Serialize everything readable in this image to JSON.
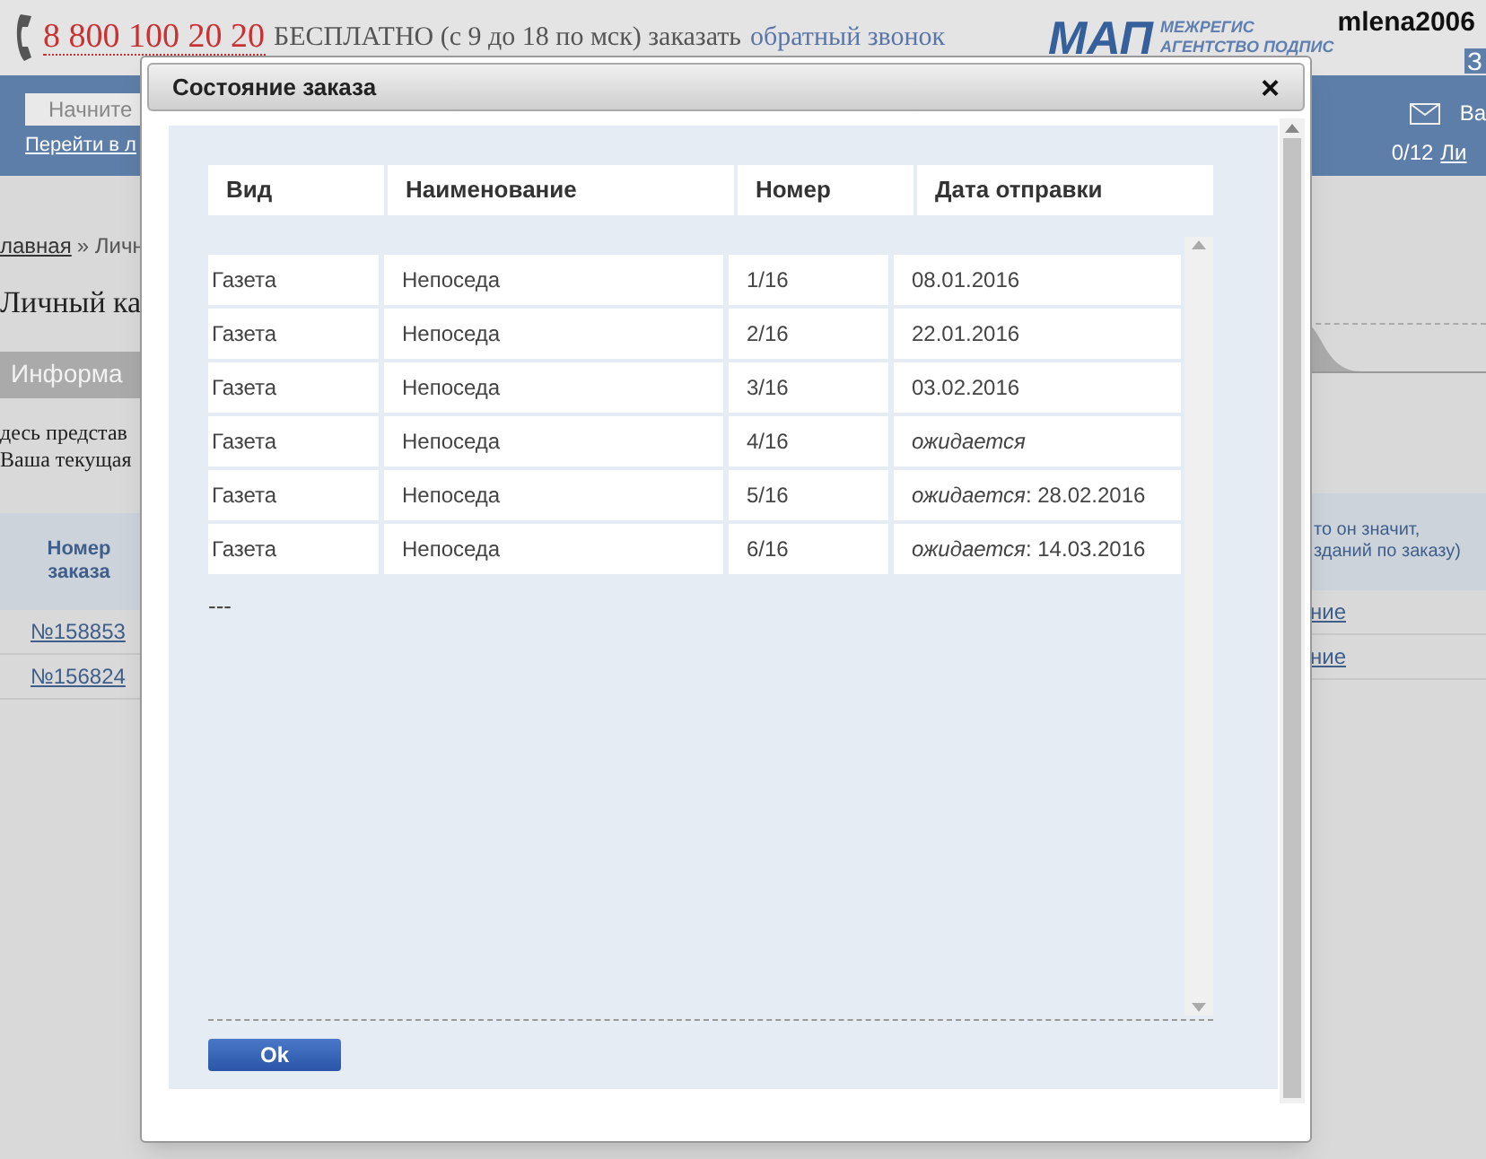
{
  "header": {
    "phone": "8 800 100 20 20",
    "phone_note": "БЕСПЛАТНО (с 9 до 18 по мск) заказать",
    "callback_link": "обратный звонок",
    "logo_mark": "МАП",
    "logo_line_1": "МЕЖРЕГИС",
    "logo_line_2": "АГЕНТСТВО ПОДПИС",
    "username": "mlena2006",
    "corner": "З"
  },
  "navbar": {
    "search": {
      "placeholder": "Начните"
    },
    "link": "Перейти в л",
    "mail_label": "Ва",
    "mail_count": "0/12",
    "mail_link": "Ли"
  },
  "page": {
    "breadcrumb_link": "лавная",
    "breadcrumb_rest": "» Личн",
    "title": "Личный ка",
    "section": "Информа",
    "text_lines": [
      "десь представ",
      "Ваша текущая"
    ],
    "table": {
      "left_header": "Номер заказа",
      "right_header_lines": [
        "то он значит,",
        "зданий по заказу)"
      ],
      "rows": [
        {
          "order": "№158853",
          "action": "ние"
        },
        {
          "order": "№156824",
          "action": "ние"
        }
      ]
    }
  },
  "dialog": {
    "title": "Состояние заказа",
    "close": "×",
    "columns": [
      "Вид",
      "Наименование",
      "Номер",
      "Дата отправки"
    ],
    "rows": [
      {
        "type": "Газета",
        "name": "Непоседа",
        "number": "1/16",
        "date": "08.01.2016"
      },
      {
        "type": "Газета",
        "name": "Непоседа",
        "number": "2/16",
        "date": "22.01.2016"
      },
      {
        "type": "Газета",
        "name": "Непоседа",
        "number": "3/16",
        "date": "03.02.2016"
      },
      {
        "type": "Газета",
        "name": "Непоседа",
        "number": "4/16",
        "date": "*ожидается*"
      },
      {
        "type": "Газета",
        "name": "Непоседа",
        "number": "5/16",
        "date": "*ожидается*: 28.02.2016"
      },
      {
        "type": "Газета",
        "name": "Непоседа",
        "number": "6/16",
        "date": "*ожидается*: 14.03.2016"
      }
    ],
    "note": "---",
    "ok": "Ok"
  }
}
